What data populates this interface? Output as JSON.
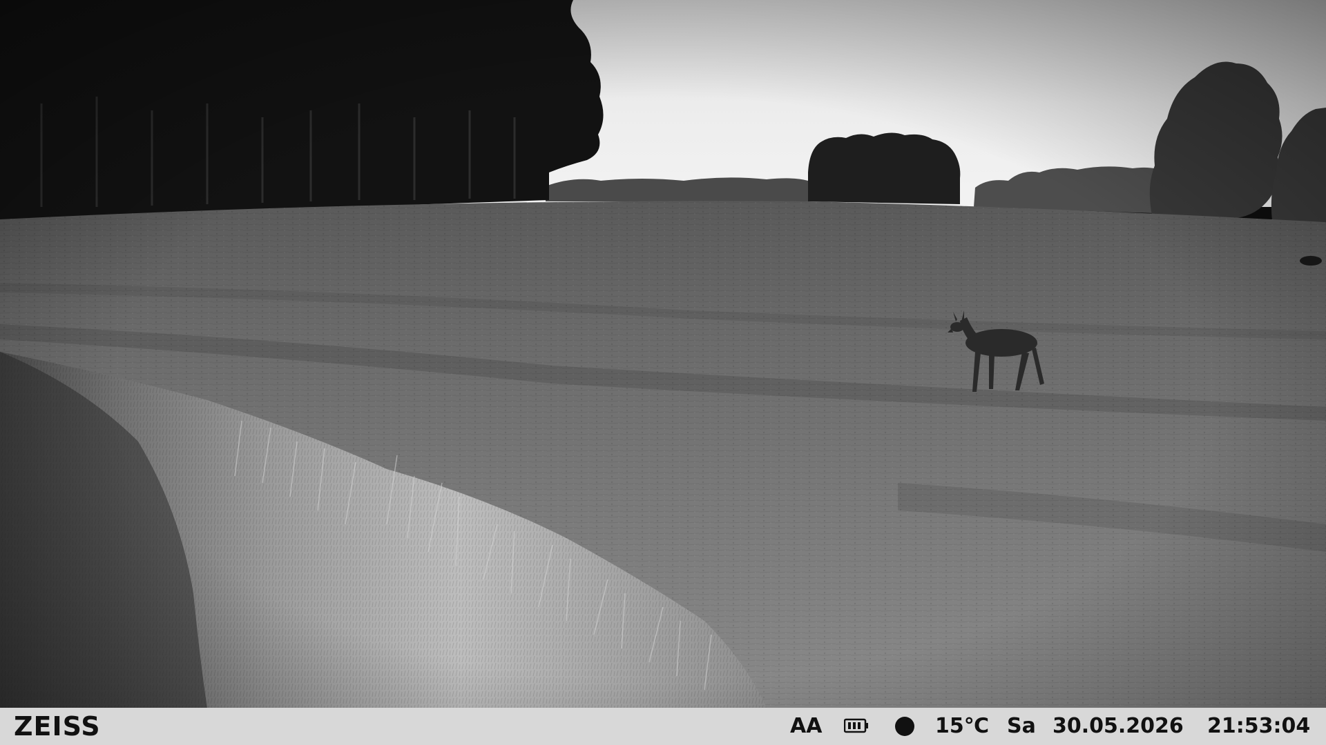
{
  "camera": {
    "brand": "ZEISS",
    "mode": "AA",
    "battery_icon": "battery-icon",
    "moon_phase_icon": "moon-full-icon",
    "temperature": "15℃",
    "weekday": "Sa",
    "date": "30.05.2026",
    "time": "21:53:04"
  },
  "scene": {
    "subject": "roe-deer",
    "style": "infrared-monochrome"
  }
}
